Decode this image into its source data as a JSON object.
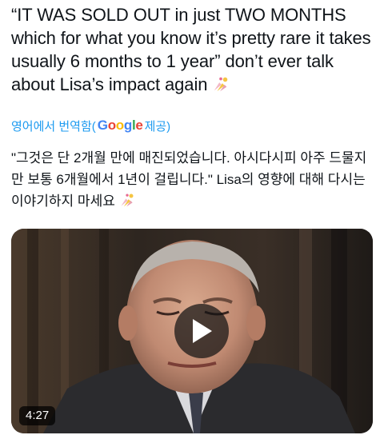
{
  "tweet": {
    "text": "“IT WAS SOLD OUT in just TWO MONTHS which for what you know it’s pretty rare it takes usually 6 months to 1 year” don’t ever talk about Lisa’s impact again",
    "emoji": "nail-polish-emoji"
  },
  "translation": {
    "prefix": "영어에서 번역함(",
    "google_g1": "G",
    "google_o1": "o",
    "google_o2": "o",
    "google_g2": "g",
    "google_l": "l",
    "google_e": "e",
    "suffix": " 제공)",
    "text": "\"그것은 단 2개월 만에 매진되었습니다. 아시다시피 아주 드물지만 보통 6개월에서 1년이 걸립니다.\" Lisa의 영향에 대해 다시는 이야기하지 마세요",
    "colors": {
      "blue": "#4285f4",
      "red": "#ea4335",
      "yellow": "#fbbc05",
      "green": "#34a853",
      "link": "#1d9bf0"
    }
  },
  "video": {
    "duration": "4:27",
    "play_icon": "play-icon"
  }
}
